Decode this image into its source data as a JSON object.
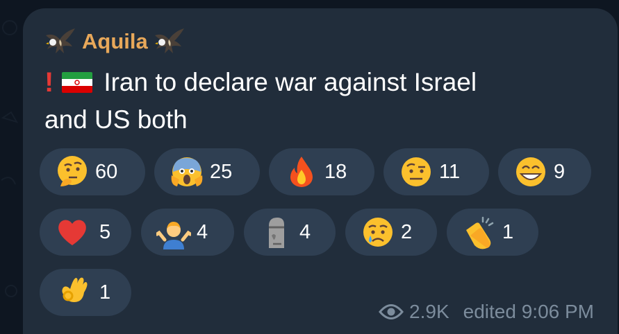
{
  "channel": {
    "name": "Aquila"
  },
  "message": {
    "line1": "Iran to declare war against Israel",
    "line2": "and US both"
  },
  "reactions": [
    {
      "emoji": "thinking-face",
      "count": "60"
    },
    {
      "emoji": "screaming-face",
      "count": "25"
    },
    {
      "emoji": "fire",
      "count": "18"
    },
    {
      "emoji": "raised-eyebrow-face",
      "count": "11"
    },
    {
      "emoji": "grinning-face",
      "count": "9"
    },
    {
      "emoji": "red-heart",
      "count": "5"
    },
    {
      "emoji": "person-shrugging",
      "count": "4"
    },
    {
      "emoji": "moai",
      "count": "4"
    },
    {
      "emoji": "crying-face",
      "count": "2"
    },
    {
      "emoji": "clapping-hands",
      "count": "1"
    },
    {
      "emoji": "ok-hand",
      "count": "1"
    }
  ],
  "meta": {
    "views": "2.9K",
    "edited": "edited 9:06 PM"
  },
  "colors": {
    "background": "#0e1621",
    "bubble": "#212d3b",
    "pill": "#2f3f52",
    "sender": "#e8a85a",
    "meta": "#7c8c9c"
  }
}
